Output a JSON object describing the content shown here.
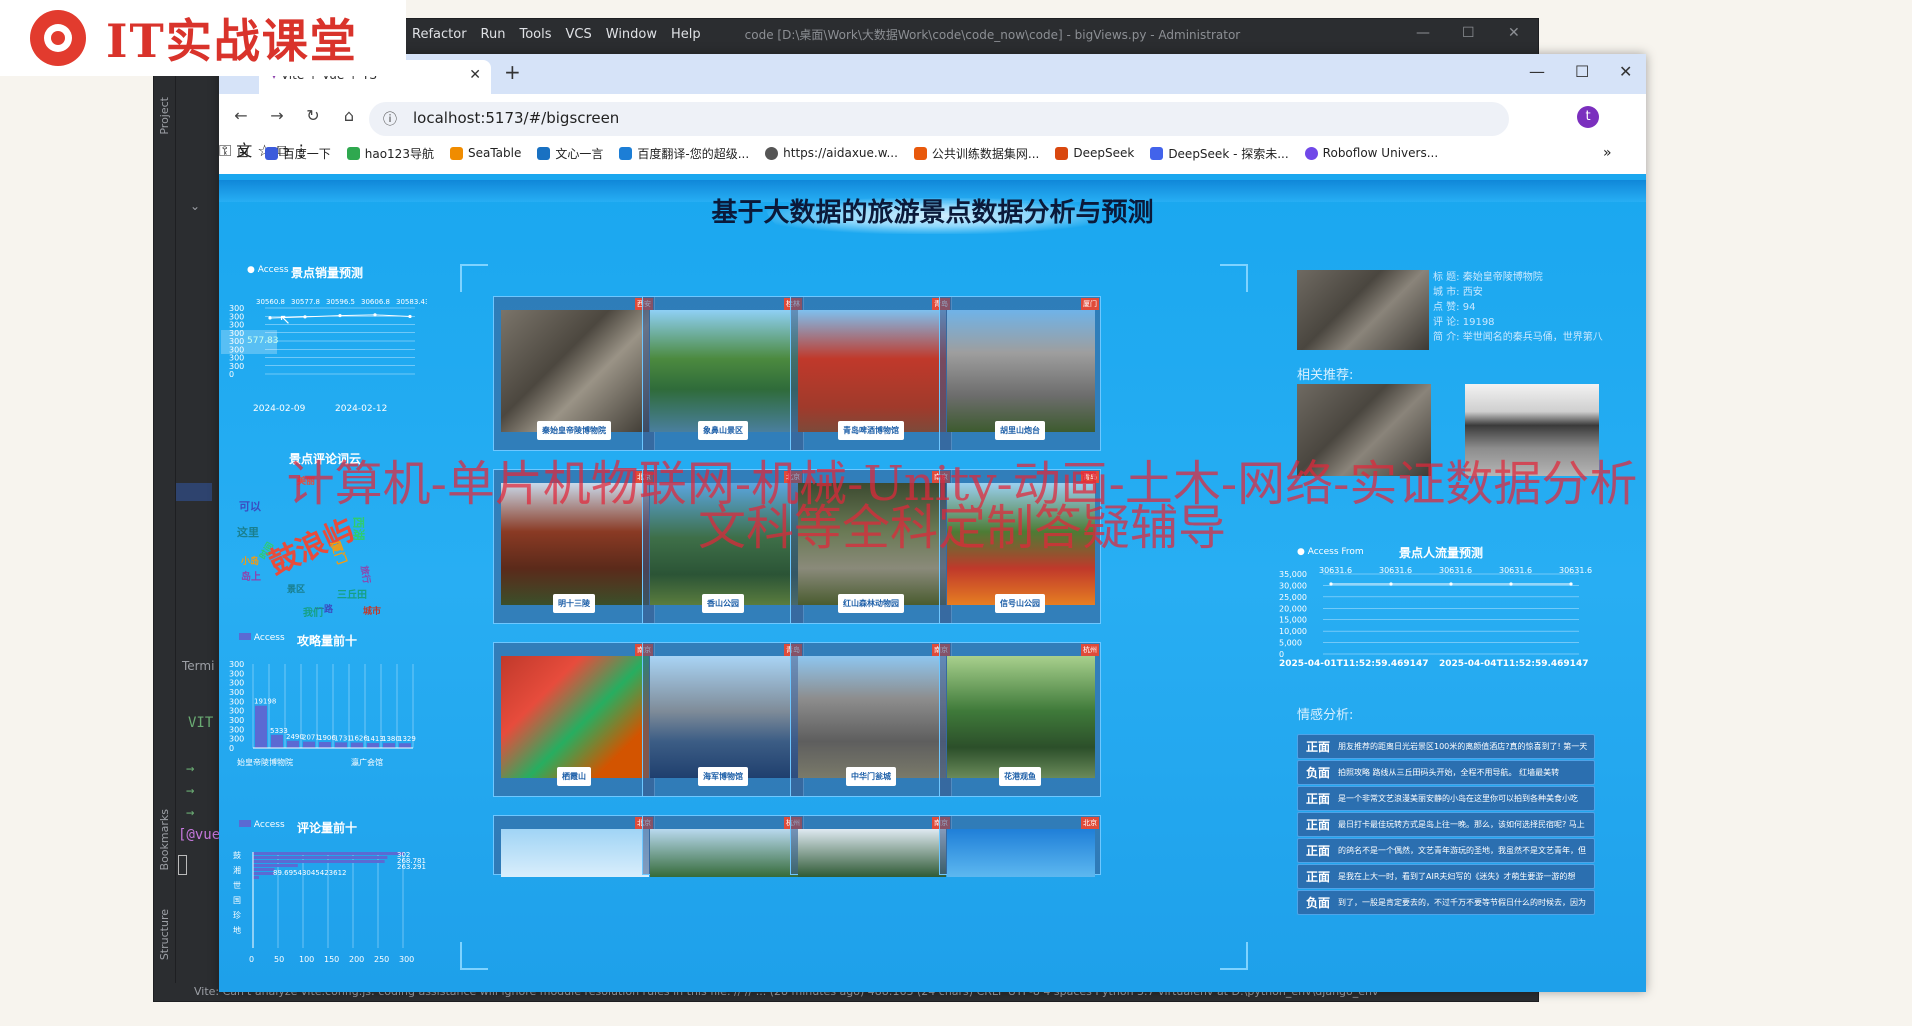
{
  "logo": {
    "text": "IT实战课堂"
  },
  "ide": {
    "menu": [
      "Refactor",
      "Run",
      "Tools",
      "VCS",
      "Window",
      "Help"
    ],
    "title": "code [D:\\桌面\\Work\\大数据Work\\code\\code_now\\code] - bigViews.py - Administrator",
    "side_tabs": {
      "project": "Project",
      "bookmarks": "Bookmarks",
      "structure": "Structure"
    },
    "terminal_label": "Termi",
    "terminal_lines": [
      "VIT",
      "→",
      "→",
      "→",
      "[@vue"
    ],
    "status": "Vite: Can't analyze vite.config.js: coding assistance will ignore module resolution rules in this file. // // ... (28 minutes ago)        488:163 (24 chars)   CRLF   UTF-8   4 spaces   Python 3.7 virtualenv at D:\\python_env\\django_env"
  },
  "browser": {
    "tab_title": "Vite + Vue + TS",
    "url": "localhost:5173/#/bigscreen",
    "bookmarks": [
      {
        "label": "百度一下",
        "color": "#3b5bdb"
      },
      {
        "label": "hao123导航",
        "color": "#2fa84f"
      },
      {
        "label": "SeaTable",
        "color": "#f08c00"
      },
      {
        "label": "文心一言",
        "color": "#1971c2"
      },
      {
        "label": "百度翻译-您的超级...",
        "color": "#1c7ed6"
      },
      {
        "label": "https://aidaxue.w...",
        "color": "#555555"
      },
      {
        "label": "公共训练数据集网...",
        "color": "#e8590c"
      },
      {
        "label": "DeepSeek",
        "color": "#d9480f"
      },
      {
        "label": "DeepSeek - 探索未...",
        "color": "#4263eb"
      },
      {
        "label": "Roboflow Univers...",
        "color": "#7048e8"
      }
    ]
  },
  "dashboard": {
    "title": "基于大数据的旅游景点数据分析与预测",
    "sales": {
      "title": "景点销量预测",
      "legend": "Access",
      "values": [
        30560.8,
        30577.8,
        30596.5,
        30606.8,
        30583.43
      ],
      "dates": [
        "2024-02-09",
        "2024-02-12"
      ],
      "tooltip": "577.83",
      "yticks": [
        "300",
        "300",
        "300",
        "300",
        "300",
        "300",
        "300",
        "300",
        "0"
      ]
    },
    "wordcloud": {
      "title": "景点评论词云",
      "words": [
        "鼓浪屿",
        "可以",
        "这里",
        "西湖",
        "厦门",
        "岛上",
        "三丘田",
        "城市",
        "美丽",
        "一路",
        "景区",
        "时间",
        "小岛",
        "旅行",
        "我们"
      ]
    },
    "guide": {
      "title": "攻略量前十",
      "legend": "Access",
      "values": [
        19198,
        5333,
        2490,
        2071,
        1906,
        1731,
        1626,
        1413,
        1380,
        1329
      ],
      "labels": [
        "19198",
        "5333",
        "2490",
        "2071",
        "1906",
        "1731",
        "1626",
        "1413",
        "1380",
        "1329"
      ],
      "xlabels": [
        "始皇帝陵博物院",
        "瀛广会馆"
      ],
      "yticks": [
        "300",
        "300",
        "300",
        "300",
        "300",
        "300",
        "300",
        "300",
        "300",
        "0"
      ]
    },
    "comment": {
      "title": "评论量前十",
      "legend": "Access",
      "values": [
        302,
        268.781,
        263.291,
        89.695,
        43.045,
        42.36,
        12
      ],
      "labels": [
        "302",
        "268.781",
        "263.291",
        "89.69543045423612"
      ],
      "xticks": [
        "0",
        "50",
        "100",
        "150",
        "200",
        "250",
        "300"
      ],
      "yl": [
        "鼓",
        "湘",
        "世",
        "国",
        "珍",
        "地"
      ]
    },
    "spots": [
      {
        "name": "秦始皇帝陵博物院",
        "tag": "西安",
        "theme": "terracotta"
      },
      {
        "name": "象鼻山景区",
        "tag": "桂林",
        "theme": "river"
      },
      {
        "name": "青岛啤酒博物馆",
        "tag": "青岛",
        "theme": "redbrick"
      },
      {
        "name": "胡里山炮台",
        "tag": "厦门",
        "theme": "fort"
      },
      {
        "name": "明十三陵",
        "tag": "北京",
        "theme": "temple"
      },
      {
        "name": "香山公园",
        "tag": "北京",
        "theme": "mountain"
      },
      {
        "name": "红山森林动物园",
        "tag": "南京",
        "theme": "zoo"
      },
      {
        "name": "信号山公园",
        "tag": "青岛",
        "theme": "flowers"
      },
      {
        "name": "栖霞山",
        "tag": "南京",
        "theme": "autumn"
      },
      {
        "name": "海军博物馆",
        "tag": "青岛",
        "theme": "ship"
      },
      {
        "name": "中华门瓮城",
        "tag": "南京",
        "theme": "wall"
      },
      {
        "name": "花港观鱼",
        "tag": "杭州",
        "theme": "garden"
      },
      {
        "name": "",
        "tag": "北京",
        "theme": "sky"
      },
      {
        "name": "",
        "tag": "杭州",
        "theme": "tree"
      },
      {
        "name": "",
        "tag": "南京",
        "theme": "forest"
      },
      {
        "name": "",
        "tag": "北京",
        "theme": "blue"
      }
    ],
    "detail": {
      "lines": [
        "标 题: 秦始皇帝陵博物院",
        "城 市: 西安",
        "点 赞: 94",
        "评 论: 19198",
        "简 介: 举世闻名的秦兵马俑，世界第八"
      ],
      "related_label": "相关推荐:"
    },
    "flow": {
      "title": "景点人流量预测",
      "legend": "Access From",
      "values": [
        30631.6,
        30631.6,
        30631.6,
        30631.6,
        30631.6
      ],
      "labels": [
        "30631.6",
        "30631.6",
        "30631.6",
        "30631.6",
        "30631.6"
      ],
      "yticks": [
        "35,000",
        "30,000",
        "25,000",
        "20,000",
        "15,000",
        "10,000",
        "5,000",
        "0"
      ],
      "dates": [
        "2025-04-01T11:52:59.469147",
        "2025-04-04T11:52:59.469147"
      ]
    },
    "sentiment": {
      "title": "情感分析:",
      "rows": [
        {
          "label": "正面",
          "text": "朋友推荐的距离日光岩景区100米的离颜值酒店?真的惊喜到了! 第一天"
        },
        {
          "label": "负面",
          "text": "拍照攻略 路线从三丘田码头开始，全程不用导航。 红墙最美转"
        },
        {
          "label": "正面",
          "text": "是一个非常文艺浪漫美丽安静的小岛在这里你可以拍到各种美食小吃"
        },
        {
          "label": "正面",
          "text": "最日打卡最佳玩转方式是岛上往一晚。那么，该如何选择民宿呢? 马上"
        },
        {
          "label": "正面",
          "text": "的鸽名不是一个偶然，文艺青年游玩的圣地，我虽然不是文艺青年，但"
        },
        {
          "label": "正面",
          "text": "是我在上大一时，看到了AIR夫妇写的《迷失》才萌生要游一游的想"
        },
        {
          "label": "负面",
          "text": "到了，一股是肯定要去的，不过千万不要等节假日什么的时候去，因为"
        }
      ]
    }
  },
  "watermark": {
    "line1": "计算机-单片机物联网-机械-Unity-动画-土木-网络-实证数据分析",
    "line2": "文科等全科定制答疑辅导"
  }
}
